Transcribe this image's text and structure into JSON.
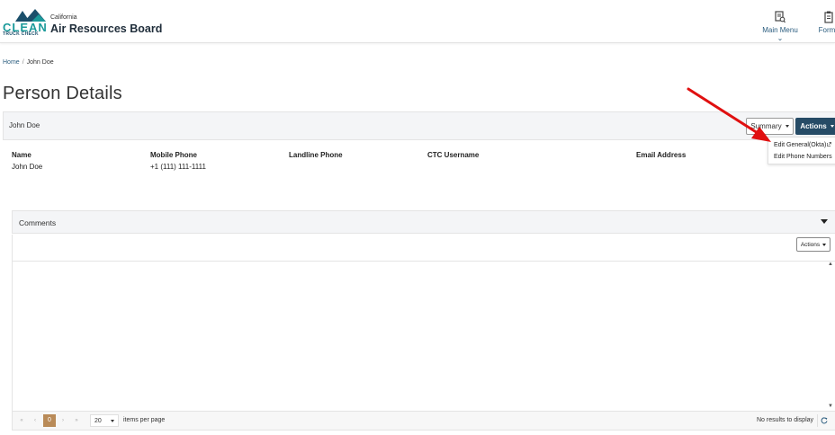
{
  "header": {
    "logo_main": "CLEAN",
    "logo_sub": "TRUCK CHECK",
    "brand_small": "California",
    "brand_big": "Air Resources Board",
    "nav": {
      "main_menu": "Main Menu",
      "forms": "Forms"
    }
  },
  "breadcrumb": {
    "home": "Home",
    "separator": "/",
    "current": "John Doe"
  },
  "page_title": "Person Details",
  "person_card": {
    "title": "John Doe",
    "summary_button": "Summary",
    "actions_button": "Actions",
    "dropdown": [
      {
        "label": "Edit General(Okta)"
      },
      {
        "label": "Edit Phone Numbers"
      }
    ],
    "fields": [
      {
        "label": "Name",
        "value": "John Doe"
      },
      {
        "label": "Mobile Phone",
        "value": "+1 (111) 111-1111"
      },
      {
        "label": "Landline Phone",
        "value": ""
      },
      {
        "label": "CTC Username",
        "value": ""
      },
      {
        "label": "Email Address",
        "value": ""
      }
    ]
  },
  "comments": {
    "title": "Comments",
    "actions_button": "Actions",
    "pager": {
      "first": "«",
      "prev": "‹",
      "current_page": "0",
      "next": "›",
      "last": "»",
      "page_size": "20",
      "items_per_page": "items per page",
      "empty_message": "No results to display"
    }
  },
  "colors": {
    "brand_teal": "#1b9a9a",
    "actions_bg": "#264b66",
    "pager_current": "#b98b58",
    "annotation_arrow": "#e01010"
  }
}
